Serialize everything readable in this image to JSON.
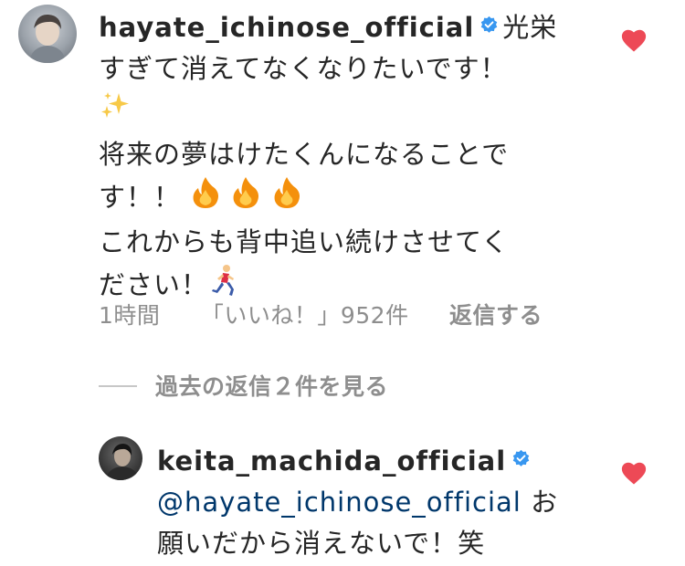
{
  "main_comment": {
    "username": "hayate_ichinose_official",
    "line1_text": "光栄",
    "line2": "すぎて消えてなくなりたいです！",
    "line3_emoji": "sparkles",
    "line4": "将来の夢はけたくんになることで",
    "line5": "す！！",
    "line5_emoji": "fire",
    "line6": "これからも背中追い続けさせてく",
    "line7": "ださい！",
    "line7_emoji": "person-running",
    "time": "1時間",
    "likes": "「いいね！」952件",
    "reply_label": "返信する",
    "liked": true
  },
  "view_replies": "過去の返信２件を見る",
  "reply_comment": {
    "username": "keita_machida_official",
    "mention": "@hayate_ichinose_official",
    "line1_rest": "お",
    "line2": "願いだから消えないで！笑",
    "liked": true
  },
  "colors": {
    "text": "#262626",
    "secondary": "#8e8e8e",
    "verified": "#3897f0",
    "heart": "#ed4956",
    "mention": "#00376b"
  }
}
